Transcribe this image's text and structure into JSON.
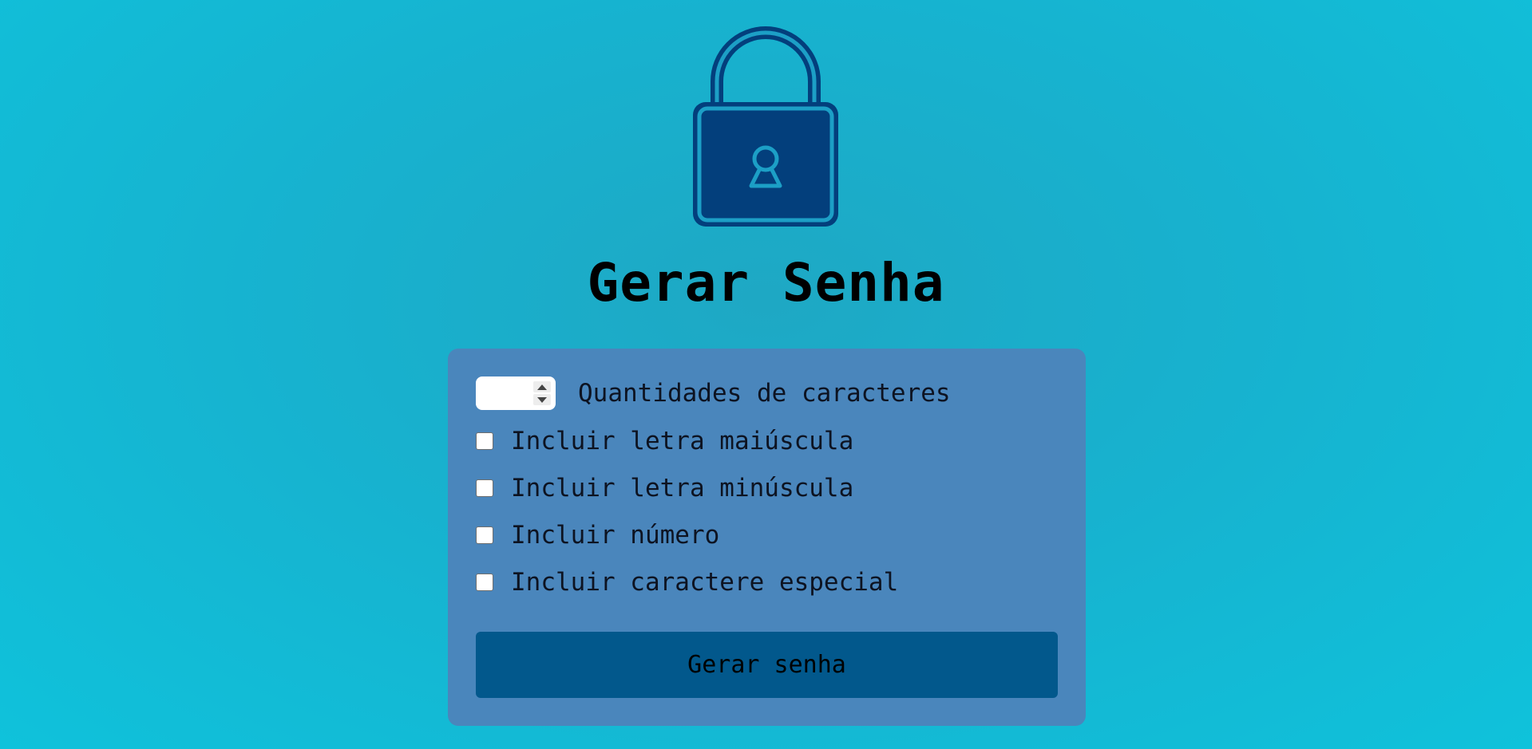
{
  "page": {
    "title": "Gerar Senha",
    "icon": "padlock-icon"
  },
  "form": {
    "length_input": {
      "value": "",
      "label": "Quantidades de caracteres"
    },
    "options": [
      {
        "label": "Incluir letra maiúscula",
        "checked": false
      },
      {
        "label": "Incluir letra minúscula",
        "checked": false
      },
      {
        "label": "Incluir número",
        "checked": false
      },
      {
        "label": "Incluir caractere especial",
        "checked": false
      }
    ],
    "submit_label": "Gerar senha"
  },
  "colors": {
    "background": "#17b2cf",
    "panel": "#4a86bc",
    "button": "#02588c",
    "lock_dark": "#033f7c",
    "lock_accent": "#1c9fc6"
  }
}
